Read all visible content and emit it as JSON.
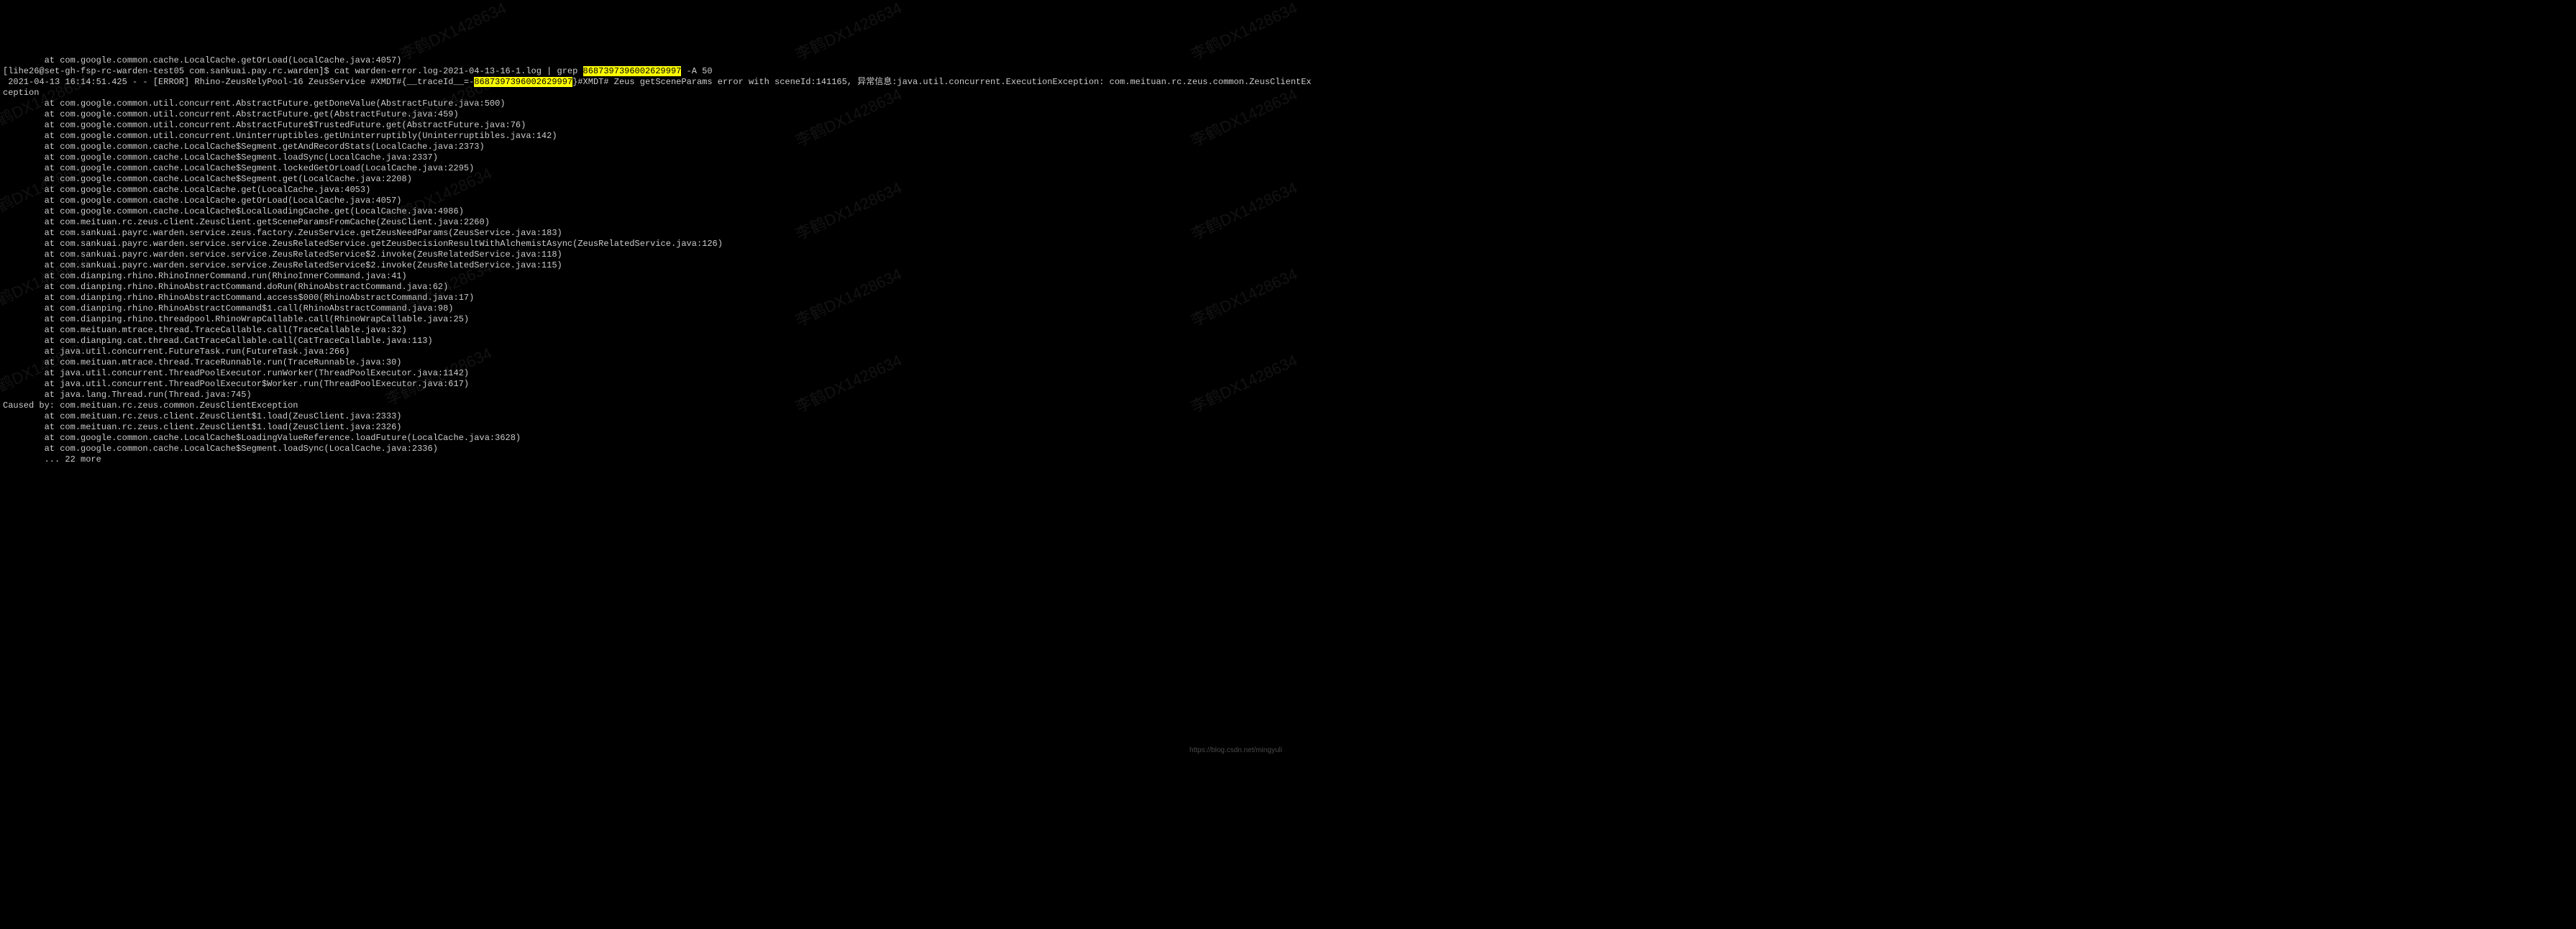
{
  "terminal": {
    "line0_prefix": "        at com.google.common.cache.LocalCache.getOrLoad(LocalCache.java:4057)",
    "prompt_prefix": "[lihe26@set-gh-fsp-rc-warden-test05 com.sankuai.pay.rc.warden]$ ",
    "command_part1": "cat warden-error.log-2021-04-13-16-1.log | grep ",
    "search_term": "8687397396002629997",
    "command_part2": " -A 50",
    "error_line_part1": " 2021-04-13 16:14:51.425 - - [ERROR] Rhino-ZeusRelyPool-16 ZeusService #XMDT#{__traceId__=-",
    "error_line_highlight": "8687397396002629997",
    "error_line_part2": "}#XMDT# Zeus getSceneParams error with sceneId:141165, 异常信息:java.util.concurrent.ExecutionException: com.meituan.rc.zeus.common.ZeusClientEx",
    "error_line_cont": "ception",
    "stack_lines": [
      "        at com.google.common.util.concurrent.AbstractFuture.getDoneValue(AbstractFuture.java:500)",
      "        at com.google.common.util.concurrent.AbstractFuture.get(AbstractFuture.java:459)",
      "        at com.google.common.util.concurrent.AbstractFuture$TrustedFuture.get(AbstractFuture.java:76)",
      "        at com.google.common.util.concurrent.Uninterruptibles.getUninterruptibly(Uninterruptibles.java:142)",
      "        at com.google.common.cache.LocalCache$Segment.getAndRecordStats(LocalCache.java:2373)",
      "        at com.google.common.cache.LocalCache$Segment.loadSync(LocalCache.java:2337)",
      "        at com.google.common.cache.LocalCache$Segment.lockedGetOrLoad(LocalCache.java:2295)",
      "        at com.google.common.cache.LocalCache$Segment.get(LocalCache.java:2208)",
      "        at com.google.common.cache.LocalCache.get(LocalCache.java:4053)",
      "        at com.google.common.cache.LocalCache.getOrLoad(LocalCache.java:4057)",
      "        at com.google.common.cache.LocalCache$LocalLoadingCache.get(LocalCache.java:4986)",
      "        at com.meituan.rc.zeus.client.ZeusClient.getSceneParamsFromCache(ZeusClient.java:2260)",
      "        at com.sankuai.payrc.warden.service.zeus.factory.ZeusService.getZeusNeedParams(ZeusService.java:183)",
      "        at com.sankuai.payrc.warden.service.service.ZeusRelatedService.getZeusDecisionResultWithAlchemistAsync(ZeusRelatedService.java:126)",
      "        at com.sankuai.payrc.warden.service.service.ZeusRelatedService$2.invoke(ZeusRelatedService.java:118)",
      "        at com.sankuai.payrc.warden.service.service.ZeusRelatedService$2.invoke(ZeusRelatedService.java:115)",
      "        at com.dianping.rhino.RhinoInnerCommand.run(RhinoInnerCommand.java:41)",
      "        at com.dianping.rhino.RhinoAbstractCommand.doRun(RhinoAbstractCommand.java:62)",
      "        at com.dianping.rhino.RhinoAbstractCommand.access$000(RhinoAbstractCommand.java:17)",
      "        at com.dianping.rhino.RhinoAbstractCommand$1.call(RhinoAbstractCommand.java:98)",
      "        at com.dianping.rhino.threadpool.RhinoWrapCallable.call(RhinoWrapCallable.java:25)",
      "        at com.meituan.mtrace.thread.TraceCallable.call(TraceCallable.java:32)",
      "        at com.dianping.cat.thread.CatTraceCallable.call(CatTraceCallable.java:113)",
      "        at java.util.concurrent.FutureTask.run(FutureTask.java:266)",
      "        at com.meituan.mtrace.thread.TraceRunnable.run(TraceRunnable.java:30)",
      "        at java.util.concurrent.ThreadPoolExecutor.runWorker(ThreadPoolExecutor.java:1142)",
      "        at java.util.concurrent.ThreadPoolExecutor$Worker.run(ThreadPoolExecutor.java:617)",
      "        at java.lang.Thread.run(Thread.java:745)"
    ],
    "caused_by": "Caused by: com.meituan.rc.zeus.common.ZeusClientException",
    "caused_stack": [
      "        at com.meituan.rc.zeus.client.ZeusClient$1.load(ZeusClient.java:2333)",
      "        at com.meituan.rc.zeus.client.ZeusClient$1.load(ZeusClient.java:2326)",
      "        at com.google.common.cache.LocalCache$LoadingValueReference.loadFuture(LocalCache.java:3628)",
      "        at com.google.common.cache.LocalCache$Segment.loadSync(LocalCache.java:2336)",
      "        ... 22 more"
    ]
  },
  "watermark_text": "李鹤DX1428634",
  "footer_url": "https://blog.csdn.net/mingyuli"
}
